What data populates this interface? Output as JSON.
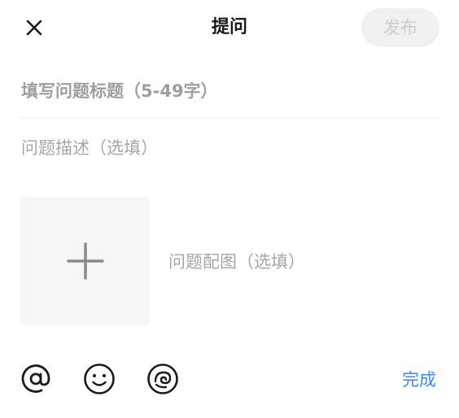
{
  "header": {
    "title": "提问",
    "publish_label": "发布",
    "close_icon": "close-icon"
  },
  "form": {
    "title_placeholder": "填写问题标题（5-49字）",
    "title_value": "",
    "description_placeholder": "问题描述（选填）",
    "description_value": "",
    "image_hint": "问题配图（选填）",
    "image_icon": "plus-icon"
  },
  "toolbar": {
    "icons": [
      "at-icon",
      "emoji-icon",
      "topic-icon"
    ],
    "done_label": "完成"
  },
  "colors": {
    "accent": "#3e87e6",
    "publish_bg": "#f0f0f0",
    "publish_text": "#cccccc",
    "placeholder": "#a6a6a6",
    "upload_bg": "#f5f6f6"
  }
}
